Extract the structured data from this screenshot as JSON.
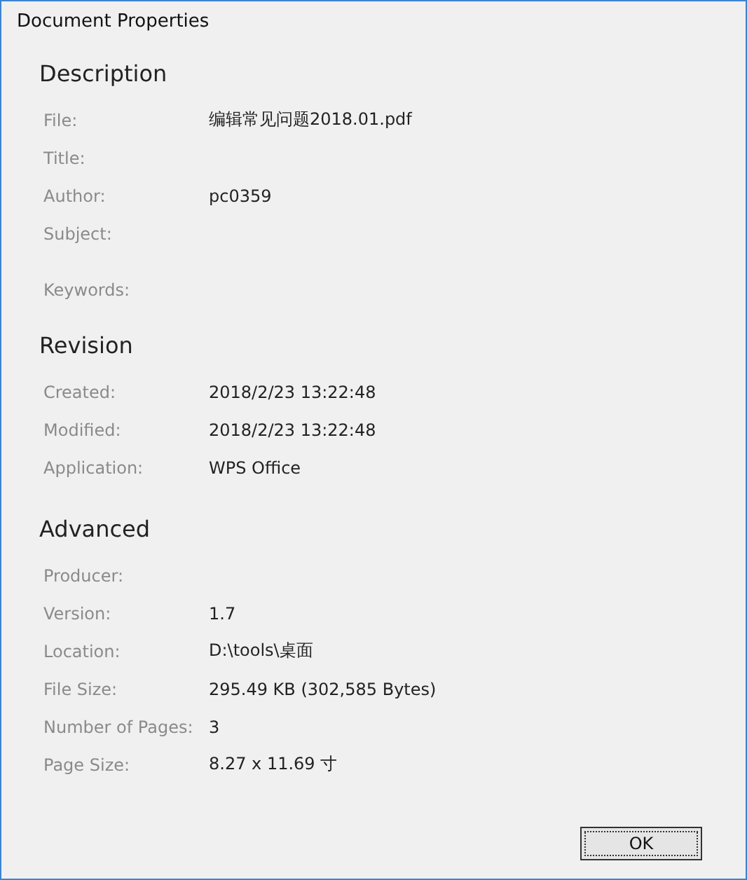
{
  "window": {
    "title": "Document Properties"
  },
  "sections": [
    {
      "title": "Description",
      "rows": [
        {
          "label": "File:",
          "value": "编辑常见问题2018.01.pdf"
        },
        {
          "label": "Title:"
        },
        {
          "label": "Author:",
          "value": "pc0359"
        },
        {
          "label": "Subject:"
        },
        {
          "label": "Keywords:",
          "kind": "multiline"
        }
      ]
    },
    {
      "title": "Revision",
      "rows": [
        {
          "label": "Created:",
          "value": "2018/2/23 13:22:48"
        },
        {
          "label": "Modified:",
          "value": "2018/2/23 13:22:48"
        },
        {
          "label": "Application:",
          "value": "WPS Office"
        }
      ]
    },
    {
      "title": "Advanced",
      "rows": [
        {
          "label": "Producer:"
        },
        {
          "label": "Version:",
          "value": "1.7"
        },
        {
          "label": "Location:",
          "value": "D:\\tools\\桌面"
        },
        {
          "label": "File Size:",
          "value": "295.49 KB (302,585 Bytes)"
        },
        {
          "label": "Number of Pages:",
          "value": "3"
        },
        {
          "label": "Page Size:",
          "value": "8.27 x 11.69 寸"
        }
      ]
    }
  ],
  "buttons": [
    {
      "label": "OK"
    }
  ]
}
